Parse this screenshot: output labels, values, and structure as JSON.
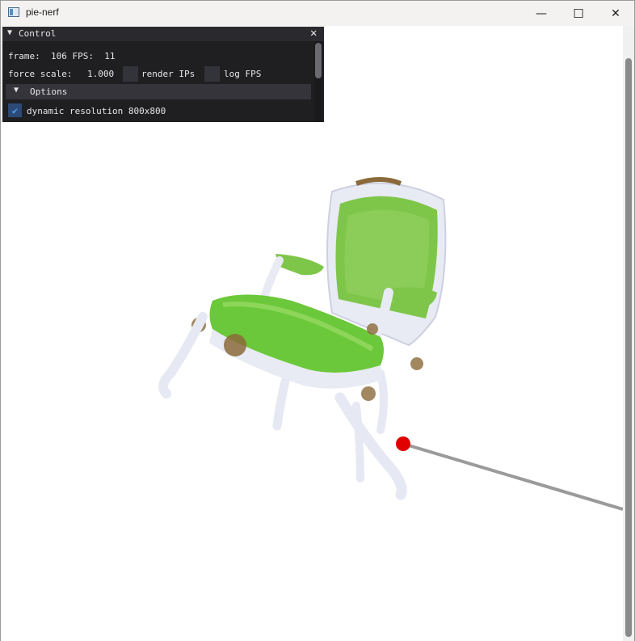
{
  "window": {
    "title": "pie-nerf"
  },
  "title_buttons": {
    "minimize": "—",
    "maximize": "☐",
    "close": "✕"
  },
  "control_panel": {
    "title": "Control",
    "collapse_arrow": "▼",
    "close": "✕",
    "frame_line": "frame:  106 FPS:  11",
    "force_scale_label": "force scale:",
    "force_scale_value": "1.000",
    "render_ips_label": "render IPs",
    "log_fps_label": "log FPS",
    "options": {
      "arrow": "▼",
      "title": "Options",
      "dynamic_resolution_label": "dynamic resolution 800x800",
      "dynamic_resolution_checked": true,
      "check_glyph": "✔"
    }
  },
  "scene": {
    "subject": "ornate armchair with green damask upholstery",
    "colors": {
      "upholstery": "#6bc83a",
      "frame": "#e8eaf4",
      "gilding": "#8a6a3a",
      "force_line": "#9a9a9a",
      "drag_point": "#e00000"
    }
  }
}
